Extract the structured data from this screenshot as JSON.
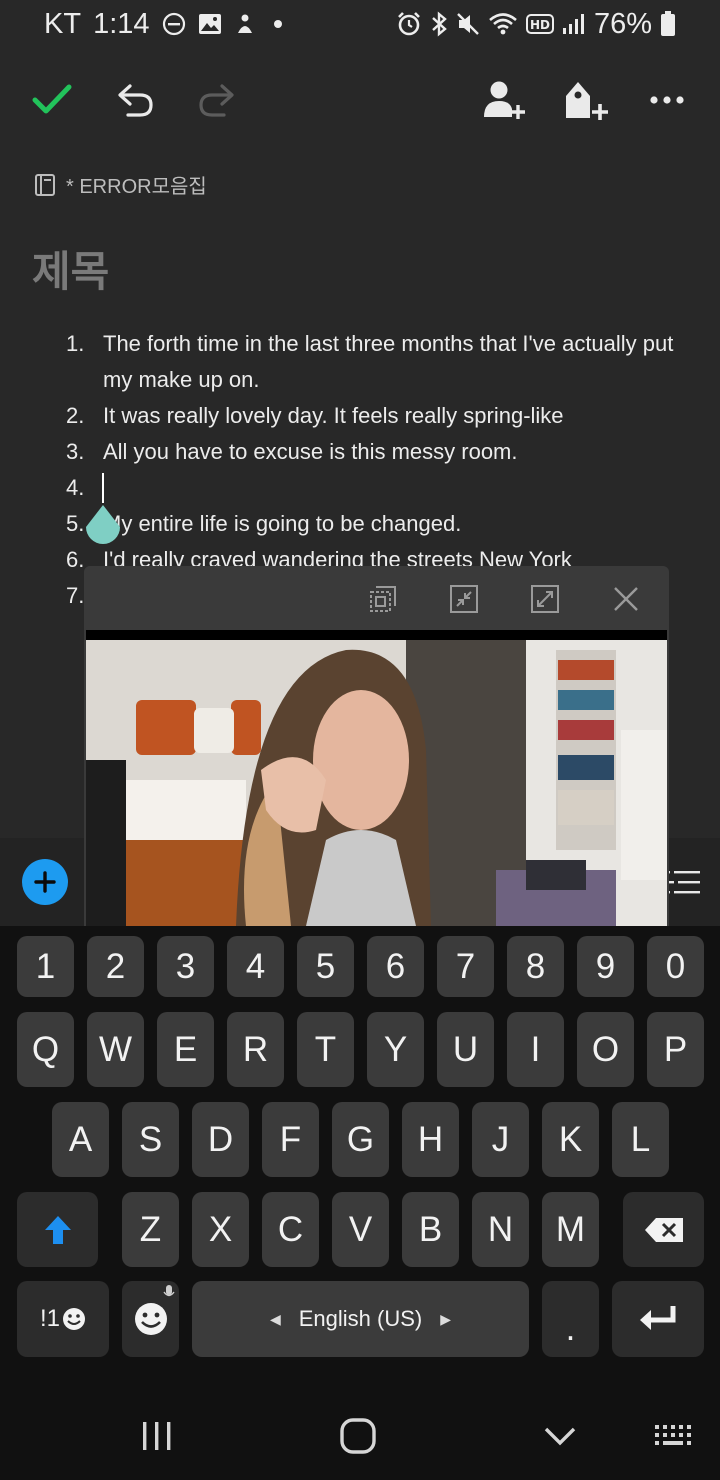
{
  "status_bar": {
    "carrier": "KT",
    "time": "1:14",
    "battery": "76%"
  },
  "toolbar": {
    "colors": {
      "check": "#22c35b",
      "icon": "#eaeaea",
      "disabled": "#5c5c5c"
    }
  },
  "notebook": {
    "name": "* ERROR모음집"
  },
  "note": {
    "title": "제목",
    "items": [
      {
        "num": "1.",
        "text": "The forth time in the last three months that I've actually put my make up on."
      },
      {
        "num": "2.",
        "text": "It was really lovely day. It feels really spring-like"
      },
      {
        "num": "3.",
        "text": "All you have to excuse is this messy room."
      },
      {
        "num": "4.",
        "text": ""
      },
      {
        "num": "5.",
        "text": "My entire life is going to be changed."
      },
      {
        "num": "6.",
        "text": "I'd really craved wandering the streets New York"
      },
      {
        "num": "7.",
        "text": ""
      }
    ]
  },
  "keyboard": {
    "numbers": [
      "1",
      "2",
      "3",
      "4",
      "5",
      "6",
      "7",
      "8",
      "9",
      "0"
    ],
    "row_q": [
      "Q",
      "W",
      "E",
      "R",
      "T",
      "Y",
      "U",
      "I",
      "O",
      "P"
    ],
    "row_a": [
      "A",
      "S",
      "D",
      "F",
      "G",
      "H",
      "J",
      "K",
      "L"
    ],
    "row_z": [
      "Z",
      "X",
      "C",
      "V",
      "B",
      "N",
      "M"
    ],
    "symbols_label": "!1",
    "language": "English (US)",
    "period": ".",
    "colors": {
      "shift_arrow": "#1d8ff0"
    }
  },
  "colors": {
    "accent": "#1d9bf0",
    "handle": "#7fcfc4"
  }
}
